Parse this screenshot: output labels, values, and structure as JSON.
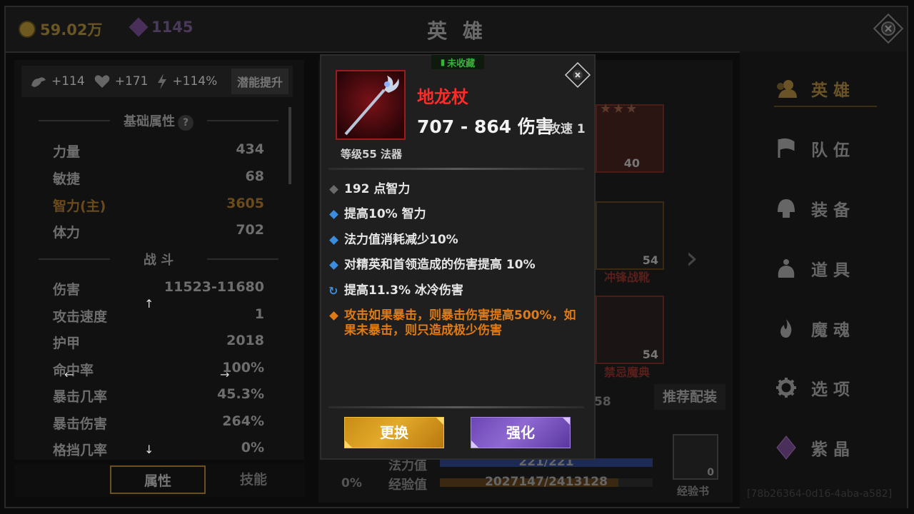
{
  "topbar": {
    "gold": "59.02万",
    "gems": "1145",
    "title": "英 雄"
  },
  "stat_bar": {
    "power": "+114",
    "health": "+171",
    "speed": "+114%",
    "potential_btn": "潜能提升"
  },
  "base_attr": {
    "heading": "基础属性",
    "help": "?",
    "rows": [
      {
        "label": "力量",
        "value": "434"
      },
      {
        "label": "敏捷",
        "value": "68"
      },
      {
        "label": "智力(主)",
        "value": "3605"
      },
      {
        "label": "体力",
        "value": "702"
      }
    ]
  },
  "combat": {
    "heading": "战 斗",
    "rows": [
      {
        "label": "伤害",
        "value": "11523-11680"
      },
      {
        "label": "攻击速度",
        "value": "1"
      },
      {
        "label": "护甲",
        "value": "2018"
      },
      {
        "label": "命中率",
        "value": "100%"
      },
      {
        "label": "暴击几率",
        "value": "45.3%"
      },
      {
        "label": "暴击伤害",
        "value": "264%"
      },
      {
        "label": "格挡几率",
        "value": "0%"
      }
    ]
  },
  "tabs": {
    "attributes": "属性",
    "skills": "技能"
  },
  "nav": {
    "items": [
      "英 雄",
      "队 伍",
      "装 备",
      "道 具",
      "魔 魂",
      "选 项",
      "紫 晶"
    ]
  },
  "background": {
    "slot1_num": "40",
    "slot2_num": "54",
    "slot2_name": "冲锋战靴",
    "slot3_num": "54",
    "slot3_name": "禁忌魔典",
    "recommend": "推荐配装",
    "partial_num": "58",
    "mana_label": "法力值",
    "mana_value": "221/221",
    "mana_fill": 1.0,
    "exp_label": "经验值",
    "exp_value": "2027147/2413128",
    "exp_fill": 0.84,
    "percent": "0%",
    "exp_book_label": "经验书",
    "exp_book_count": "0"
  },
  "popup": {
    "badge": "未收藏",
    "name": "地龙杖",
    "damage": "707 - 864 伤害",
    "speed": "攻速 1",
    "level": "等级55 法器",
    "affixes": [
      {
        "text": "192 点智力",
        "type": "base"
      },
      {
        "text": "提高10% 智力",
        "type": "magic"
      },
      {
        "text": "法力值消耗减少10%",
        "type": "magic"
      },
      {
        "text": "对精英和首领造成的伤害提高 10%",
        "type": "magic"
      },
      {
        "text": "提高11.3% 冰冷伤害",
        "type": "cold"
      },
      {
        "text": "攻击如果暴击，则暴击伤害提高500%，如果未暴击，则只造成极少伤害",
        "type": "legendary"
      }
    ],
    "btn_swap": "更换",
    "btn_upgrade": "强化"
  },
  "watermark": "[78b26364-0d16-4aba-a582]",
  "colors": {
    "legendary": "#ff2a2a",
    "orange_affix": "#e07a15",
    "magic": "#3a8ddf",
    "gold_button": "#d79d1f",
    "purple_button": "#7c58c4"
  }
}
